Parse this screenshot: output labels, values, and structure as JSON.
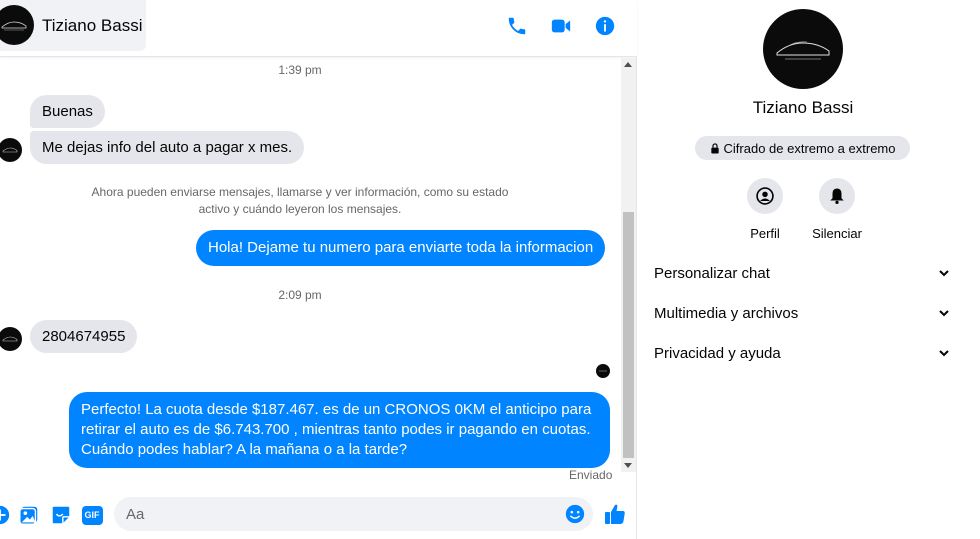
{
  "header": {
    "contact_name": "Tiziano Bassi",
    "icons": [
      "phone-icon",
      "video-icon",
      "info-icon"
    ]
  },
  "messages": {
    "timestamp_1": "1:39 pm",
    "incoming_1": "Buenas",
    "incoming_2": "Me dejas info del auto a pagar x mes.",
    "system_note_line1": "Ahora pueden enviarse mensajes, llamarse y ver información, como su estado",
    "system_note_line2": "activo y cuándo leyeron los mensajes.",
    "outgoing_1": "Hola! Dejame tu numero  para enviarte toda la informacion",
    "timestamp_2": "2:09 pm",
    "incoming_3": "2804674955",
    "outgoing_2_line1": "Perfecto! La cuota desde $187.467. es de un CRONOS 0KM el anticipo para",
    "outgoing_2_line2": "retirar el auto es de $6.743.700 , mientras tanto podes ir pagando en cuotas.",
    "outgoing_2_line3": "Cuándo podes hablar? A la mañana o a la tarde?",
    "status": "Enviado"
  },
  "composer": {
    "placeholder": "Aa",
    "gif_label": "GIF",
    "icons": [
      "plus-icon",
      "image-icon",
      "sticker-icon",
      "gif-icon",
      "emoji-icon",
      "like-icon"
    ]
  },
  "panel": {
    "contact_name": "Tiziano Bassi",
    "encryption": "Cifrado de extremo a extremo",
    "actions": [
      {
        "label": "Perfil"
      },
      {
        "label": "Silenciar"
      }
    ],
    "sections": [
      {
        "label": "Personalizar chat"
      },
      {
        "label": "Multimedia y archivos"
      },
      {
        "label": "Privacidad y ayuda"
      }
    ]
  },
  "colors": {
    "accent": "#0084ff",
    "incoming_bubble": "#e4e6eb",
    "secondary_text": "#65676b"
  }
}
